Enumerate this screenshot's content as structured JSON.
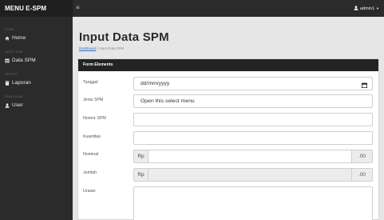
{
  "sidebar": {
    "brand": "MENU E-SPM",
    "sections": [
      {
        "heading": "CORE",
        "item": {
          "label": "Home",
          "icon": "home-icon"
        }
      },
      {
        "heading": "INPUT SPM",
        "item": {
          "label": "Data SPM",
          "icon": "table-icon"
        }
      },
      {
        "heading": "REPORT",
        "item": {
          "label": "Laporan",
          "icon": "book-icon"
        }
      },
      {
        "heading": "PENGGUNA",
        "item": {
          "label": "User",
          "icon": "user-icon"
        }
      }
    ]
  },
  "topbar": {
    "menu_icon": "menu-icon",
    "user": "admin1"
  },
  "page": {
    "title": "Input Data SPM",
    "breadcrumb": {
      "link": "Dashboard",
      "separator": "/",
      "current": "Input Data SPM"
    }
  },
  "card": {
    "header": "Form Elements",
    "fields": {
      "tanggal": {
        "label": "Tanggal",
        "placeholder": "dd/mm/yyyy"
      },
      "jenis": {
        "label": "Jenis SPM",
        "value": "Open this select menu"
      },
      "nomor": {
        "label": "Nomor SPM",
        "value": ""
      },
      "kuantitas": {
        "label": "Kuantitas",
        "value": ""
      },
      "nominal": {
        "label": "Nominal",
        "prefix": "Rp",
        "suffix": ".00"
      },
      "jumlah": {
        "label": "Jumlah",
        "prefix": "Rp",
        "suffix": ".00"
      },
      "uraian": {
        "label": "Uraian",
        "value": ""
      }
    }
  },
  "colors": {
    "sidebar": "#2b2b2b",
    "card_header": "#232323",
    "link": "#2f6fc0"
  }
}
